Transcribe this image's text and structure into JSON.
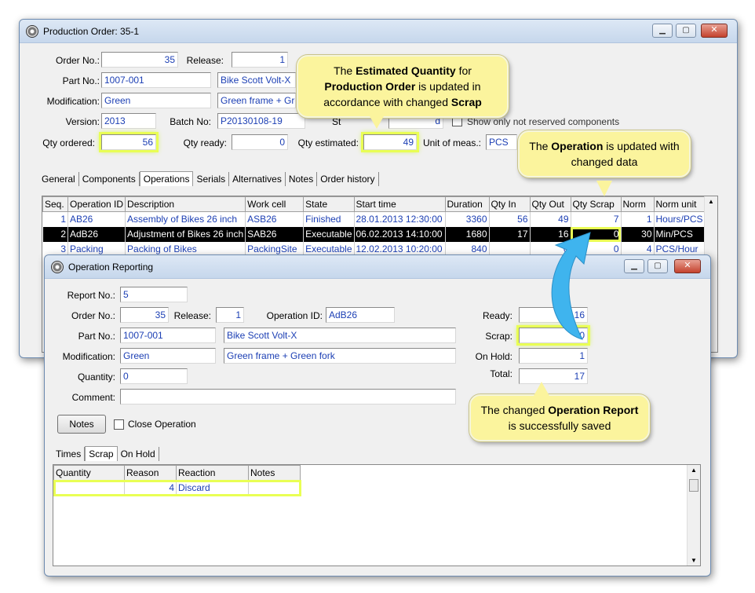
{
  "prod": {
    "title": "Production Order: 35-1",
    "order_no_label": "Order No.:",
    "order_no": "35",
    "release_label": "Release:",
    "release": "1",
    "part_no_label": "Part No.:",
    "part_no": "1007-001",
    "part_desc": "Bike Scott Volt-X",
    "modification_label": "Modification:",
    "modification": "Green",
    "modification_desc": "Green frame + Gre",
    "version_label": "Version:",
    "version": "2013",
    "batch_label": "Batch No:",
    "batch": "P20130108-19",
    "status_label_partial": "St",
    "status_value_partial": "d",
    "show_only_label": "Show only not reserved components",
    "qty_ordered_label": "Qty ordered:",
    "qty_ordered": "56",
    "qty_ready_label": "Qty ready:",
    "qty_ready": "0",
    "qty_estimated_label": "Qty estimated:",
    "qty_estimated": "49",
    "unit_label": "Unit of meas.:",
    "unit": "PCS",
    "tabs": [
      "General",
      "Components",
      "Operations",
      "Serials",
      "Alternatives",
      "Notes",
      "Order history"
    ],
    "ops_headers": [
      "Seq.",
      "Operation ID",
      "Description",
      "Work cell",
      "State",
      "Start time",
      "Duration",
      "Qty In",
      "Qty Out",
      "Qty Scrap",
      "Norm",
      "Norm unit"
    ],
    "ops_rows": [
      [
        "1",
        "AB26",
        "Assembly of Bikes 26 inch",
        "ASB26",
        "Finished",
        "28.01.2013 12:30:00",
        "3360",
        "56",
        "49",
        "7",
        "1",
        "Hours/PCS"
      ],
      [
        "2",
        "AdB26",
        "Adjustment of Bikes 26 inch",
        "SAB26",
        "Executable",
        "06.02.2013 14:10:00",
        "1680",
        "17",
        "16",
        "0",
        "30",
        "Min/PCS"
      ],
      [
        "3",
        "Packing",
        "Packing of Bikes",
        "PackingSite",
        "Executable",
        "12.02.2013 10:20:00",
        "840",
        "",
        "0",
        "0",
        "4",
        "PCS/Hour"
      ]
    ]
  },
  "rep": {
    "title": "Operation Reporting",
    "report_no_label": "Report No.:",
    "report_no": "5",
    "order_no_label": "Order No.:",
    "order_no": "35",
    "release_label": "Release:",
    "release": "1",
    "op_id_label": "Operation ID:",
    "op_id": "AdB26",
    "part_no_label": "Part No.:",
    "part_no": "1007-001",
    "part_desc": "Bike Scott Volt-X",
    "modification_label": "Modification:",
    "modification": "Green",
    "modification_desc": "Green frame + Green fork",
    "quantity_label": "Quantity:",
    "quantity": "0",
    "comment_label": "Comment:",
    "comment": "",
    "ready_label": "Ready:",
    "ready": "16",
    "scrap_label": "Scrap:",
    "scrap": "0",
    "onhold_label": "On Hold:",
    "onhold": "1",
    "total_label": "Total:",
    "total": "17",
    "notes_button": "Notes",
    "close_op_label": "Close Operation",
    "tabs": [
      "Times",
      "Scrap",
      "On Hold"
    ],
    "scrap_headers": [
      "Quantity",
      "Reason",
      "Reaction",
      "Notes"
    ],
    "scrap_rows": [
      [
        "",
        "4",
        "Discard",
        ""
      ]
    ]
  },
  "callouts": {
    "estimated": {
      "t1": "The ",
      "b1": "Estimated Quantity",
      "t2": " for",
      "b2": "Production  Order",
      "t3": " is updated in accordance with changed ",
      "b3": "Scrap"
    },
    "operation": {
      "t1": "The ",
      "b1": "Operation",
      "t2": " is updated with changed data"
    },
    "report": {
      "t1": "The changed ",
      "b1": "Operation Report",
      "t2": " is successfully saved"
    }
  },
  "colors": {
    "highlight": "#e9ff54",
    "callout_bg": "#fbf49d",
    "value_text": "#1c3fb4",
    "arrow": "#3fb4ee"
  }
}
